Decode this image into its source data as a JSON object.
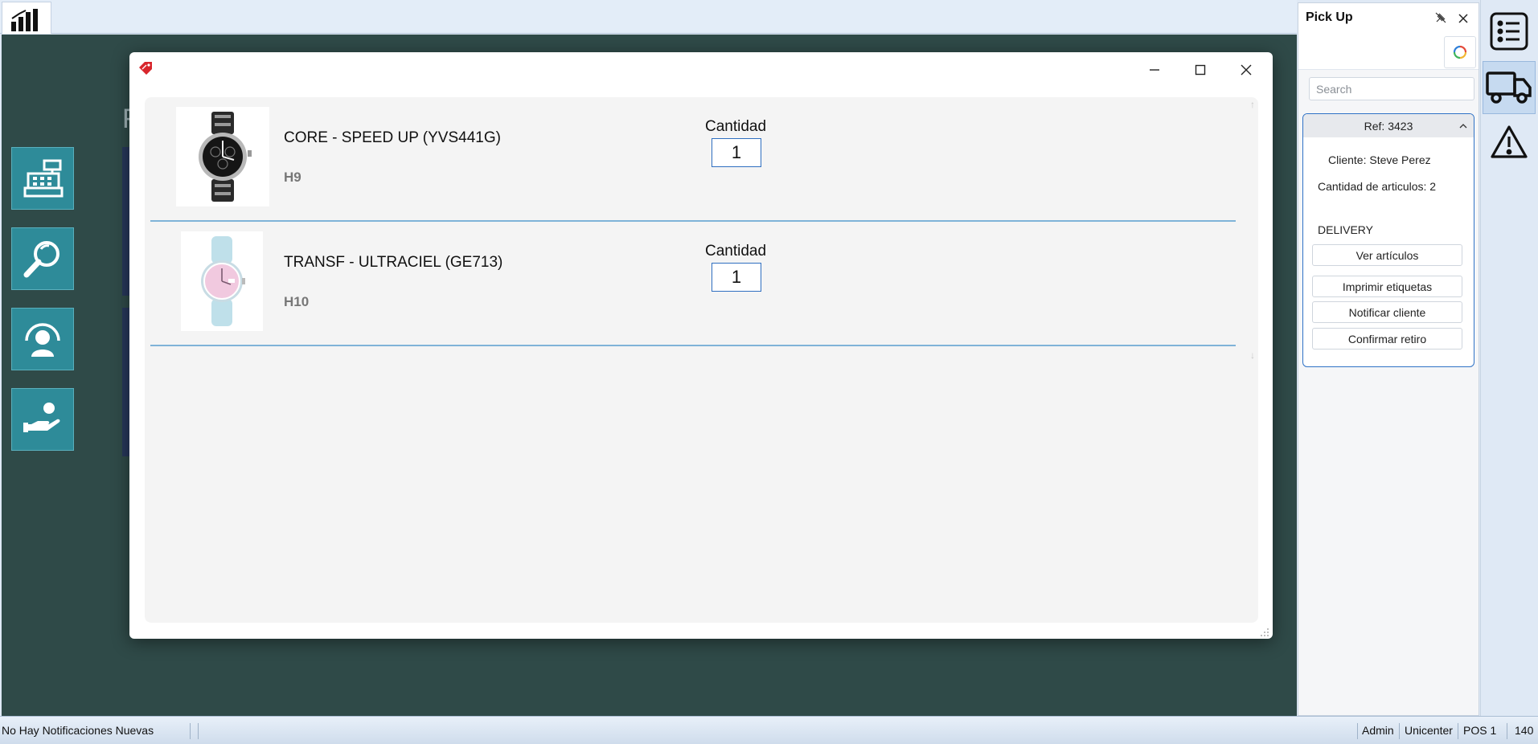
{
  "modal": {
    "items": [
      {
        "title": "CORE - SPEED UP (YVS441G)",
        "location": "H9",
        "quantity_label": "Cantidad",
        "quantity": "1"
      },
      {
        "title": "TRANSF - ULTRACIEL (GE713)",
        "location": "H10",
        "quantity_label": "Cantidad",
        "quantity": "1"
      }
    ]
  },
  "pickup": {
    "title": "Pick Up",
    "search_placeholder": "Search",
    "order": {
      "ref": "Ref: 3423",
      "client": "Cliente: Steve Perez",
      "item_count": "Cantidad de articulos: 2",
      "shipping": "DELIVERY",
      "buttons": {
        "view": "Ver artículos",
        "print": "Imprimir etiquetas",
        "notify": "Notificar cliente",
        "confirm": "Confirmar retiro"
      }
    }
  },
  "background": {
    "partial_letter": "F"
  },
  "status_bar": {
    "notifications": "No Hay Notificaciones Nuevas",
    "user": "Admin",
    "store": "Unicenter",
    "pos": "POS 1",
    "number": "140"
  },
  "colors": {
    "workspace": "#2f4a48",
    "tile": "#2e8b99",
    "accent_blue": "#2f72c6",
    "row_divider": "#7fb3d8"
  },
  "icons": {
    "app": "bar-chart-icon",
    "side_tiles": [
      "cash-register-icon",
      "magnifier-icon",
      "user-support-icon",
      "hand-coin-icon"
    ],
    "right_bar": [
      "list-icon",
      "delivery-truck-icon",
      "warning-icon"
    ]
  }
}
